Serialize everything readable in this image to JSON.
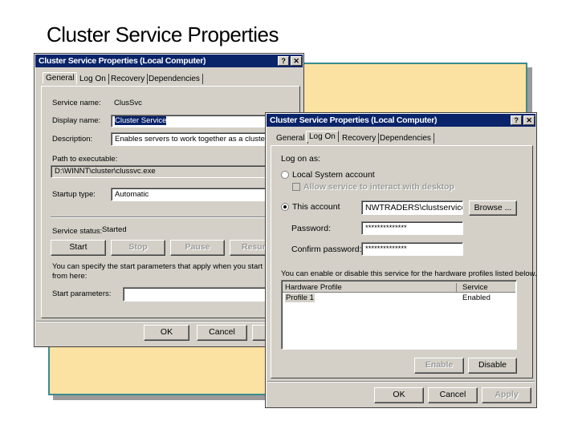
{
  "slide": {
    "title": "Cluster Service Properties"
  },
  "general_dialog": {
    "title": "Cluster Service Properties (Local Computer)",
    "help": "?",
    "close": "✕",
    "tabs": [
      "General",
      "Log On",
      "Recovery",
      "Dependencies"
    ],
    "service_name_label": "Service name:",
    "service_name": "ClusSvc",
    "display_name_label": "Display name:",
    "display_name": "Cluster Service",
    "description_label": "Description:",
    "description": "Enables servers to work together as a cluster to kee",
    "path_label": "Path to executable:",
    "path": "D:\\WINNT\\cluster\\clussvc.exe",
    "startup_label": "Startup type:",
    "startup": "Automatic",
    "status_label": "Service status:",
    "status": "Started",
    "buttons": [
      "Start",
      "Stop",
      "Pause",
      "Resum"
    ],
    "params_text_1": "You can specify the start parameters that apply when you start the servic",
    "params_text_2": "from here:",
    "params_label": "Start parameters:",
    "params_value": "",
    "ok": "OK",
    "cancel": "Cancel"
  },
  "logon_dialog": {
    "title": "Cluster Service Properties (Local Computer)",
    "help": "?",
    "close": "✕",
    "tabs": [
      "General",
      "Log On",
      "Recovery",
      "Dependencies"
    ],
    "log_on_as": "Log on as:",
    "local_system": "Local System account",
    "allow_desktop": "Allow service to interact with desktop",
    "this_account": "This account",
    "account": "NWTRADERS\\clustservice",
    "browse": "Browse ...",
    "password_label": "Password:",
    "password": "**************",
    "confirm_label": "Confirm password:",
    "confirm": "**************",
    "profiles_text": "You can enable or disable this service for the hardware profiles listed below.",
    "columns": [
      "Hardware Profile",
      "Service"
    ],
    "rows": [
      {
        "profile": "Profile 1",
        "service": "Enabled"
      }
    ],
    "enable": "Enable",
    "disable": "Disable",
    "ok": "OK",
    "cancel": "Cancel",
    "apply": "Apply"
  }
}
